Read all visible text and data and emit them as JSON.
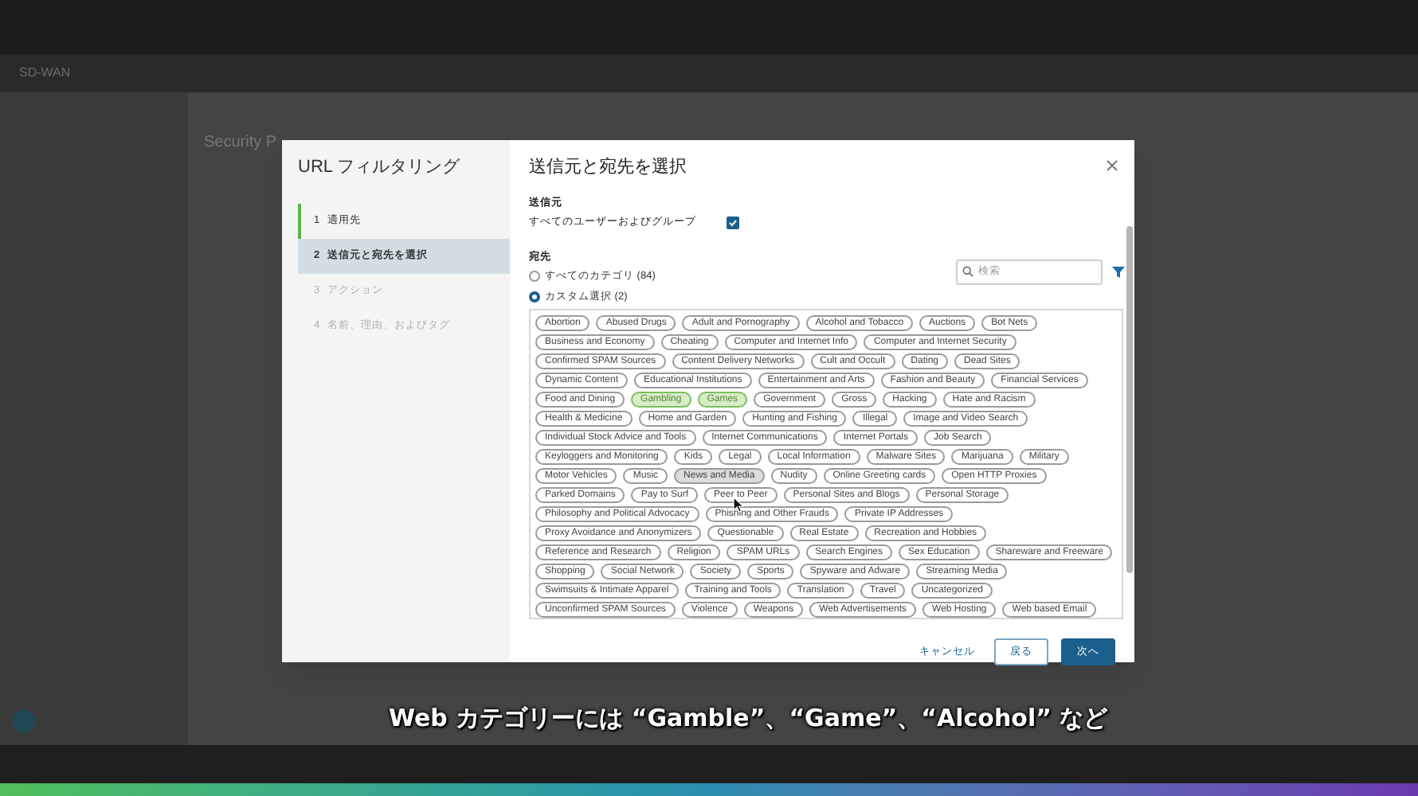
{
  "app": {
    "product": "SD-WAN",
    "page_title": "Security P"
  },
  "dialog": {
    "wizard_title": "URL フィルタリング",
    "steps": [
      {
        "number": "1",
        "label": "適用先",
        "selected": false,
        "completed": true,
        "disabled": false
      },
      {
        "number": "2",
        "label": "送信元と宛先を選択",
        "selected": true,
        "completed": false,
        "disabled": false
      },
      {
        "number": "3",
        "label": "アクション",
        "selected": false,
        "completed": false,
        "disabled": true
      },
      {
        "number": "4",
        "label": "名前、理由、およびタグ",
        "selected": false,
        "completed": false,
        "disabled": true
      }
    ],
    "title": "送信元と宛先を選択",
    "source": {
      "heading": "送信元",
      "label": "すべてのユーザーおよびグループ",
      "checked": true
    },
    "destination": {
      "heading": "宛先",
      "options": [
        {
          "label": "すべてのカテゴリ (84)",
          "selected": false
        },
        {
          "label": "カスタム選択 (2)",
          "selected": true
        }
      ],
      "search": {
        "placeholder": "検索"
      },
      "category_rows": [
        [
          {
            "label": "Abortion",
            "selected": false,
            "hovered": false
          },
          {
            "label": "Abused Drugs",
            "selected": false,
            "hovered": false
          },
          {
            "label": "Adult and Pornography",
            "selected": false,
            "hovered": false
          },
          {
            "label": "Alcohol and Tobacco",
            "selected": false,
            "hovered": false
          },
          {
            "label": "Auctions",
            "selected": false,
            "hovered": false
          },
          {
            "label": "Bot Nets",
            "selected": false,
            "hovered": false
          }
        ],
        [
          {
            "label": "Business and Economy",
            "selected": false,
            "hovered": false
          },
          {
            "label": "Cheating",
            "selected": false,
            "hovered": false
          },
          {
            "label": "Computer and Internet Info",
            "selected": false,
            "hovered": false
          },
          {
            "label": "Computer and Internet Security",
            "selected": false,
            "hovered": false
          }
        ],
        [
          {
            "label": "Confirmed SPAM Sources",
            "selected": false,
            "hovered": false
          },
          {
            "label": "Content Delivery Networks",
            "selected": false,
            "hovered": false
          },
          {
            "label": "Cult and Occult",
            "selected": false,
            "hovered": false
          },
          {
            "label": "Dating",
            "selected": false,
            "hovered": false
          },
          {
            "label": "Dead Sites",
            "selected": false,
            "hovered": false
          }
        ],
        [
          {
            "label": "Dynamic Content",
            "selected": false,
            "hovered": false
          },
          {
            "label": "Educational Institutions",
            "selected": false,
            "hovered": false
          },
          {
            "label": "Entertainment and Arts",
            "selected": false,
            "hovered": false
          },
          {
            "label": "Fashion and Beauty",
            "selected": false,
            "hovered": false
          },
          {
            "label": "Financial Services",
            "selected": false,
            "hovered": false
          }
        ],
        [
          {
            "label": "Food and Dining",
            "selected": false,
            "hovered": false
          },
          {
            "label": "Gambling",
            "selected": true,
            "hovered": false
          },
          {
            "label": "Games",
            "selected": true,
            "hovered": false
          },
          {
            "label": "Government",
            "selected": false,
            "hovered": false
          },
          {
            "label": "Gross",
            "selected": false,
            "hovered": false
          },
          {
            "label": "Hacking",
            "selected": false,
            "hovered": false
          },
          {
            "label": "Hate and Racism",
            "selected": false,
            "hovered": false
          }
        ],
        [
          {
            "label": "Health & Medicine",
            "selected": false,
            "hovered": false
          },
          {
            "label": "Home and Garden",
            "selected": false,
            "hovered": false
          },
          {
            "label": "Hunting and Fishing",
            "selected": false,
            "hovered": false
          },
          {
            "label": "Illegal",
            "selected": false,
            "hovered": false
          },
          {
            "label": "Image and Video Search",
            "selected": false,
            "hovered": false
          }
        ],
        [
          {
            "label": "Individual Stock Advice and Tools",
            "selected": false,
            "hovered": false
          },
          {
            "label": "Internet Communications",
            "selected": false,
            "hovered": false
          },
          {
            "label": "Internet Portals",
            "selected": false,
            "hovered": false
          },
          {
            "label": "Job Search",
            "selected": false,
            "hovered": false
          }
        ],
        [
          {
            "label": "Keyloggers and Monitoring",
            "selected": false,
            "hovered": false
          },
          {
            "label": "Kids",
            "selected": false,
            "hovered": false
          },
          {
            "label": "Legal",
            "selected": false,
            "hovered": false
          },
          {
            "label": "Local Information",
            "selected": false,
            "hovered": false
          },
          {
            "label": "Malware Sites",
            "selected": false,
            "hovered": false
          },
          {
            "label": "Marijuana",
            "selected": false,
            "hovered": false
          },
          {
            "label": "Military",
            "selected": false,
            "hovered": false
          }
        ],
        [
          {
            "label": "Motor Vehicles",
            "selected": false,
            "hovered": false
          },
          {
            "label": "Music",
            "selected": false,
            "hovered": false
          },
          {
            "label": "News and Media",
            "selected": false,
            "hovered": true
          },
          {
            "label": "Nudity",
            "selected": false,
            "hovered": false
          },
          {
            "label": "Online Greeting cards",
            "selected": false,
            "hovered": false
          },
          {
            "label": "Open HTTP Proxies",
            "selected": false,
            "hovered": false
          }
        ],
        [
          {
            "label": "Parked Domains",
            "selected": false,
            "hovered": false
          },
          {
            "label": "Pay to Surf",
            "selected": false,
            "hovered": false
          },
          {
            "label": "Peer to Peer",
            "selected": false,
            "hovered": false
          },
          {
            "label": "Personal Sites and Blogs",
            "selected": false,
            "hovered": false
          },
          {
            "label": "Personal Storage",
            "selected": false,
            "hovered": false
          }
        ],
        [
          {
            "label": "Philosophy and Political Advocacy",
            "selected": false,
            "hovered": false
          },
          {
            "label": "Phishing and Other Frauds",
            "selected": false,
            "hovered": false
          },
          {
            "label": "Private IP Addresses",
            "selected": false,
            "hovered": false
          }
        ],
        [
          {
            "label": "Proxy Avoidance and Anonymizers",
            "selected": false,
            "hovered": false
          },
          {
            "label": "Questionable",
            "selected": false,
            "hovered": false
          },
          {
            "label": "Real Estate",
            "selected": false,
            "hovered": false
          },
          {
            "label": "Recreation and Hobbies",
            "selected": false,
            "hovered": false
          }
        ],
        [
          {
            "label": "Reference and Research",
            "selected": false,
            "hovered": false
          },
          {
            "label": "Religion",
            "selected": false,
            "hovered": false
          },
          {
            "label": "SPAM URLs",
            "selected": false,
            "hovered": false
          },
          {
            "label": "Search Engines",
            "selected": false,
            "hovered": false
          },
          {
            "label": "Sex Education",
            "selected": false,
            "hovered": false
          },
          {
            "label": "Shareware and Freeware",
            "selected": false,
            "hovered": false
          }
        ],
        [
          {
            "label": "Shopping",
            "selected": false,
            "hovered": false
          },
          {
            "label": "Social Network",
            "selected": false,
            "hovered": false
          },
          {
            "label": "Society",
            "selected": false,
            "hovered": false
          },
          {
            "label": "Sports",
            "selected": false,
            "hovered": false
          },
          {
            "label": "Spyware and Adware",
            "selected": false,
            "hovered": false
          },
          {
            "label": "Streaming Media",
            "selected": false,
            "hovered": false
          }
        ],
        [
          {
            "label": "Swimsuits & Intimate Apparel",
            "selected": false,
            "hovered": false
          },
          {
            "label": "Training and Tools",
            "selected": false,
            "hovered": false
          },
          {
            "label": "Translation",
            "selected": false,
            "hovered": false
          },
          {
            "label": "Travel",
            "selected": false,
            "hovered": false
          },
          {
            "label": "Uncategorized",
            "selected": false,
            "hovered": false
          }
        ],
        [
          {
            "label": "Unconfirmed SPAM Sources",
            "selected": false,
            "hovered": false
          },
          {
            "label": "Violence",
            "selected": false,
            "hovered": false
          },
          {
            "label": "Weapons",
            "selected": false,
            "hovered": false
          },
          {
            "label": "Web Advertisements",
            "selected": false,
            "hovered": false
          },
          {
            "label": "Web Hosting",
            "selected": false,
            "hovered": false
          },
          {
            "label": "Web based Email",
            "selected": false,
            "hovered": false
          }
        ]
      ]
    },
    "buttons": [
      {
        "kind": "link",
        "label": "キャンセル"
      },
      {
        "kind": "secondary",
        "label": "戻る"
      },
      {
        "kind": "primary",
        "label": "次へ"
      }
    ]
  },
  "subtitle": "Web カテゴリーには “Gamble”、“Game”、“Alcohol” など"
}
